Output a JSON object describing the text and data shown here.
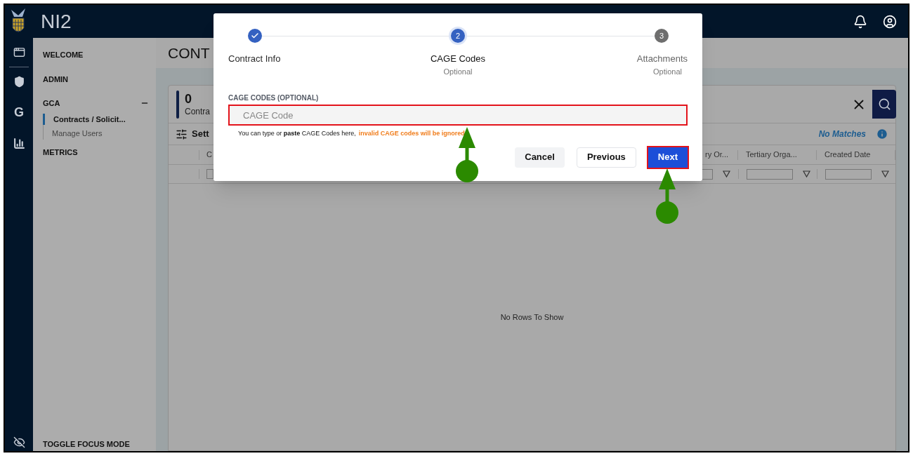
{
  "app": {
    "title": "NI2"
  },
  "rail": {
    "letter_item": "G"
  },
  "sidebar": {
    "items": [
      {
        "label": "WELCOME"
      },
      {
        "label": "ADMIN"
      },
      {
        "label": "GCA",
        "expanded": true,
        "children": [
          {
            "label": "Contracts / Solicit...",
            "selected": true
          },
          {
            "label": "Manage Users",
            "selected": false
          }
        ]
      },
      {
        "label": "METRICS"
      }
    ],
    "footer": "TOGGLE FOCUS MODE"
  },
  "page": {
    "heading": "CONT",
    "count": "0",
    "count_label": "Contra",
    "settings": "Sett",
    "status": "No Matches",
    "columns": [
      "C",
      "ry Or...",
      "Tertiary Orga...",
      "Created Date"
    ],
    "empty_message": "No Rows To Show"
  },
  "dialog": {
    "steps": [
      {
        "label": "Contract Info",
        "completed": true,
        "selected": false
      },
      {
        "number": "2",
        "label": "CAGE Codes",
        "sublabel": "Optional",
        "completed": false,
        "selected": true
      },
      {
        "number": "3",
        "label": "Attachments",
        "sublabel": "Optional",
        "completed": false,
        "selected": false
      }
    ],
    "field": {
      "label": "CAGE CODES (OPTIONAL)",
      "placeholder": "CAGE Code",
      "highlighted": true
    },
    "hint": "You can type or **paste** CAGE Codes here,",
    "warning": "invalid CAGE codes will be ignored",
    "buttons": [
      {
        "label": "Cancel",
        "kind": "secondary",
        "highlighted": false
      },
      {
        "label": "Previous",
        "kind": "outline",
        "highlighted": false
      },
      {
        "label": "Next",
        "kind": "primary",
        "highlighted": true
      }
    ]
  }
}
